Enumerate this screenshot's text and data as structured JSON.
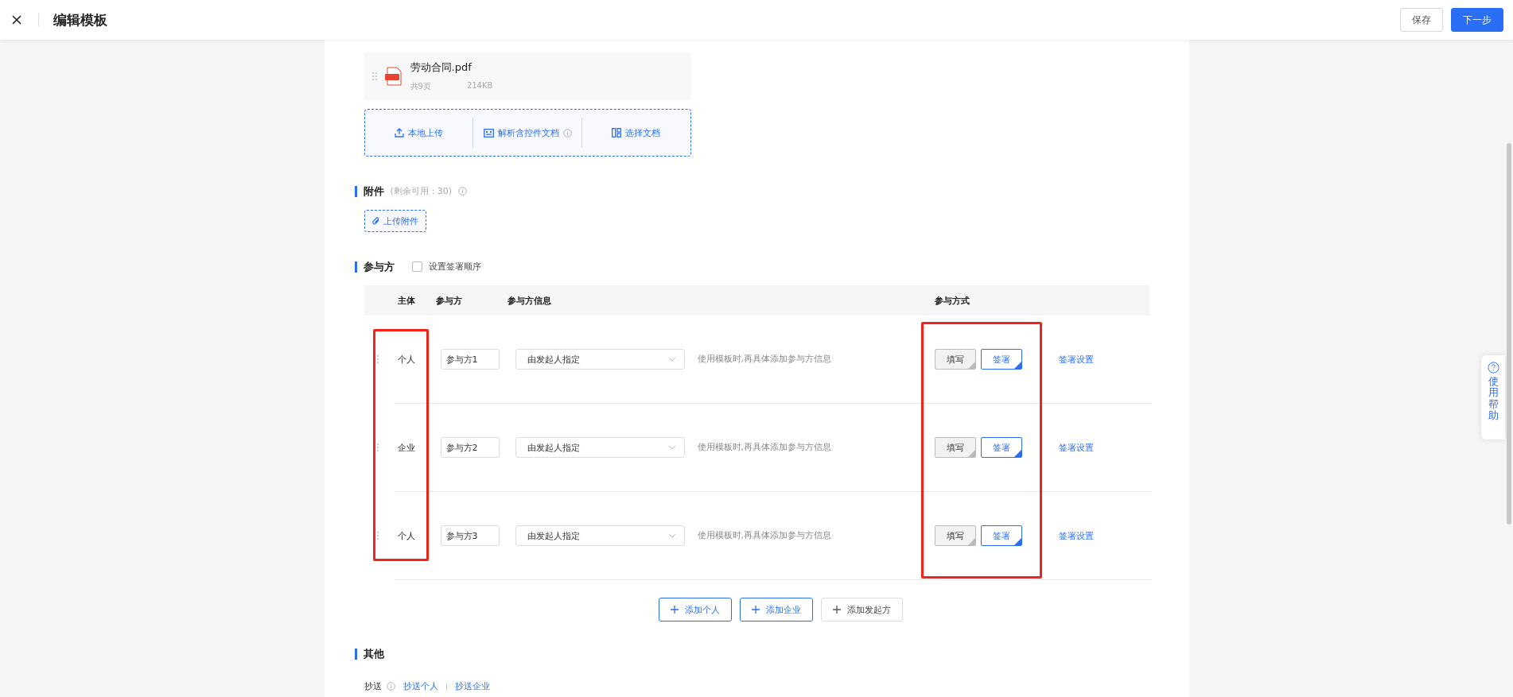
{
  "header": {
    "title": "编辑模板",
    "buttons": [
      {
        "label": "保存",
        "kind": "default"
      },
      {
        "label": "下一步",
        "kind": "primary"
      }
    ]
  },
  "document": {
    "name": "劳动合同.pdf",
    "pages": "共9页",
    "size": "214KB",
    "upload_actions": [
      {
        "label": "本地上传",
        "kind": "upload",
        "info": false
      },
      {
        "label": "解析含控件文档",
        "kind": "parse",
        "info": true
      },
      {
        "label": "选择文档",
        "kind": "choose",
        "info": false
      }
    ]
  },
  "attachments": {
    "title": "附件",
    "remaining": "(剩余可用：30)",
    "upload_button": "上传附件"
  },
  "participants": {
    "title": "参与方",
    "sign_order": {
      "label": "设置签署顺序",
      "checked": false
    },
    "columns": [
      "主体",
      "参与方",
      "参与方信息",
      "参与方式"
    ],
    "rows": [
      {
        "subject": "个人",
        "name": "参与方1",
        "select": "由发起人指定",
        "hint": "使用模板时,再具体添加参与方信息",
        "methods": [
          {
            "label": "填写",
            "selected": false
          },
          {
            "label": "签署",
            "selected": true
          }
        ],
        "link": "签署设置"
      },
      {
        "subject": "企业",
        "name": "参与方2",
        "select": "由发起人指定",
        "hint": "使用模板时,再具体添加参与方信息",
        "methods": [
          {
            "label": "填写",
            "selected": false
          },
          {
            "label": "签署",
            "selected": true
          }
        ],
        "link": "签署设置"
      },
      {
        "subject": "个人",
        "name": "参与方3",
        "select": "由发起人指定",
        "hint": "使用模板时,再具体添加参与方信息",
        "methods": [
          {
            "label": "填写",
            "selected": false
          },
          {
            "label": "签署",
            "selected": true
          }
        ],
        "link": "签署设置"
      }
    ],
    "add_buttons": [
      {
        "label": "添加个人",
        "kind": "primary"
      },
      {
        "label": "添加企业",
        "kind": "primary"
      },
      {
        "label": "添加发起方",
        "kind": "default"
      }
    ]
  },
  "other": {
    "title": "其他",
    "cc_label": "抄送",
    "cc_links": [
      "抄送个人",
      "抄送企业"
    ]
  },
  "help": {
    "label": "使用帮助"
  }
}
